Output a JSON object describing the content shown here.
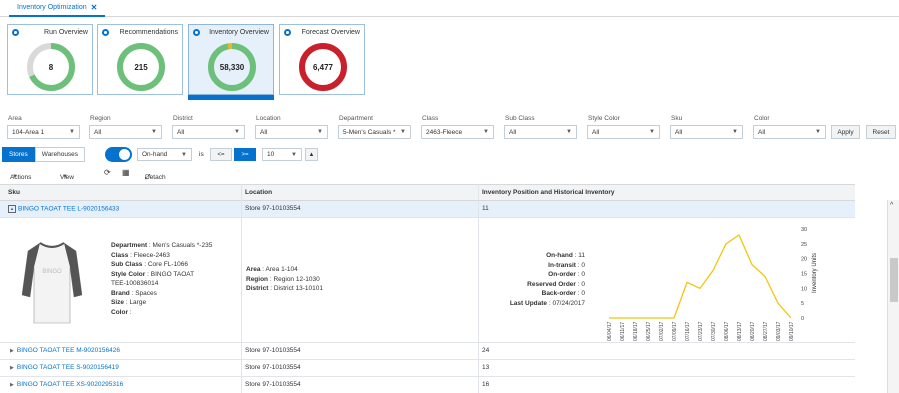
{
  "tab": {
    "label": "Inventory Optimization",
    "close": "✕"
  },
  "tiles": [
    {
      "title": "Run Overview",
      "value": "8",
      "color": "#6dc07a",
      "fraction": 0.68
    },
    {
      "title": "Recommendations",
      "value": "215",
      "color": "#6dc07a",
      "fraction": 1.0
    },
    {
      "title": "Inventory Overview",
      "value": "58,330",
      "color": "#6dc07a",
      "fraction": 0.97,
      "accent": "#f0b429"
    },
    {
      "title": "Forecast Overview",
      "value": "6,477",
      "color": "#c8212b",
      "fraction": 1.0
    }
  ],
  "filters": [
    {
      "label": "Area",
      "value": "104-Area 1"
    },
    {
      "label": "Region",
      "value": "All"
    },
    {
      "label": "District",
      "value": "All"
    },
    {
      "label": "Location",
      "value": "All"
    },
    {
      "label": "Department",
      "value": "5-Men's Casuals *"
    },
    {
      "label": "Class",
      "value": "2463-Fleece"
    },
    {
      "label": "Sub Class",
      "value": "All"
    },
    {
      "label": "Style Color",
      "value": "All"
    },
    {
      "label": "Sku",
      "value": "All"
    },
    {
      "label": "Color",
      "value": "All"
    }
  ],
  "buttons": {
    "apply": "Apply",
    "reset": "Reset"
  },
  "segment": {
    "stores": "Stores",
    "warehouses": "Warehouses"
  },
  "measure": {
    "value": "On-hand",
    "is": "is",
    "lte": "<=",
    "gte": ">=",
    "threshold": "10"
  },
  "toolbar": {
    "actions": "Actions",
    "view": "View",
    "detach": "Detach"
  },
  "grid": {
    "headers": {
      "sku": "Sku",
      "location": "Location",
      "inventory": "Inventory Position and Historical Inventory"
    },
    "rows": [
      {
        "sku": "BINGO TAOAT TEE L-9020156433",
        "location": "Store 97-10103554",
        "value": "11"
      },
      {
        "sku": "BINGO TAOAT TEE M-9020156426",
        "location": "Store 97-10103554",
        "value": "24"
      },
      {
        "sku": "BINGO TAOAT TEE S-9020156419",
        "location": "Store 97-10103554",
        "value": "13"
      },
      {
        "sku": "BINGO TAOAT TEE XS-9020295316",
        "location": "Store 97-10103554",
        "value": "16"
      }
    ]
  },
  "detail": {
    "product": [
      {
        "k": "Department",
        "v": "Men's Casuals *-235"
      },
      {
        "k": "Class",
        "v": "Fleece-2463"
      },
      {
        "k": "Sub Class",
        "v": "Core FL-1066"
      },
      {
        "k": "Style Color",
        "v": "BINGO TAOAT"
      },
      {
        "k": "",
        "v": "TEE-100836014"
      },
      {
        "k": "Brand",
        "v": "Spaces"
      },
      {
        "k": "Size",
        "v": "Large"
      },
      {
        "k": "Color",
        "v": ""
      }
    ],
    "location": [
      {
        "k": "Area",
        "v": "Area 1-104"
      },
      {
        "k": "Region",
        "v": "Region 12-1030"
      },
      {
        "k": "District",
        "v": "District 13-10101"
      }
    ],
    "inventory": [
      {
        "k": "On-hand",
        "v": "11"
      },
      {
        "k": "In-transit",
        "v": "0"
      },
      {
        "k": "On-order",
        "v": "0"
      },
      {
        "k": "Reserved Order",
        "v": "0"
      },
      {
        "k": "Back-order",
        "v": "0"
      },
      {
        "k": "Last Update",
        "v": "07/24/2017"
      }
    ]
  },
  "chart_data": {
    "type": "line",
    "x": [
      "06/04/17",
      "06/11/17",
      "06/18/17",
      "06/25/17",
      "07/02/17",
      "07/09/17",
      "07/16/17",
      "07/23/17",
      "07/30/17",
      "08/06/17",
      "08/13/17",
      "08/20/17",
      "08/27/17",
      "09/03/17",
      "09/10/17"
    ],
    "series": [
      {
        "values": [
          0,
          0,
          0,
          0,
          0,
          0,
          12,
          10,
          16,
          25,
          28,
          18,
          14,
          5,
          0
        ],
        "color": "#f2c511"
      }
    ],
    "ylabel": "Inventory Units",
    "ylim": [
      0,
      30
    ],
    "yticks": [
      0,
      5,
      10,
      15,
      20,
      25,
      30
    ]
  }
}
